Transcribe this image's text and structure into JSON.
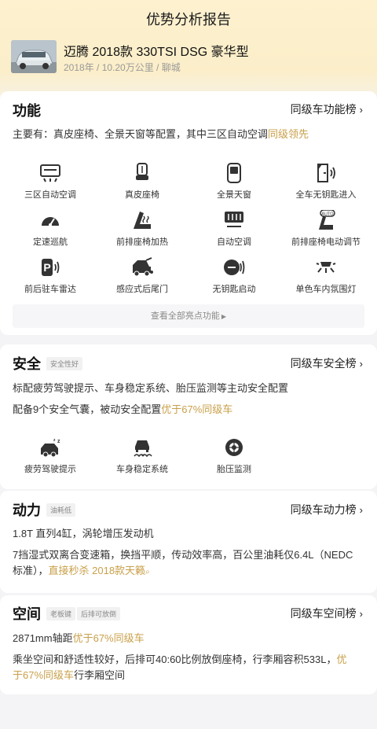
{
  "page": {
    "title": "优势分析报告"
  },
  "car": {
    "name": "迈腾 2018款 330TSI DSG 豪华型",
    "meta": "2018年 / 10.20万公里 / 聊城"
  },
  "function": {
    "title": "功能",
    "rank_link": "同级车功能榜",
    "summary_prefix": "主要有：真皮座椅、全景天窗等配置，其中三区自动空调",
    "summary_highlight": "同级领先",
    "features": [
      {
        "label": "三区自动空调",
        "icon": "ac-vent-icon"
      },
      {
        "label": "真皮座椅",
        "icon": "leather-seat-icon"
      },
      {
        "label": "全景天窗",
        "icon": "sunroof-icon"
      },
      {
        "label": "全车无钥匙进入",
        "icon": "keyless-entry-icon"
      },
      {
        "label": "定速巡航",
        "icon": "cruise-control-icon"
      },
      {
        "label": "前排座椅加热",
        "icon": "seat-heating-icon"
      },
      {
        "label": "自动空调",
        "icon": "auto-ac-icon"
      },
      {
        "label": "前排座椅电动调节",
        "icon": "power-seat-icon"
      },
      {
        "label": "前后驻车雷达",
        "icon": "parking-radar-icon"
      },
      {
        "label": "感应式后尾门",
        "icon": "sensor-tailgate-icon"
      },
      {
        "label": "无钥匙启动",
        "icon": "keyless-start-icon"
      },
      {
        "label": "单色车内氛围灯",
        "icon": "ambient-light-icon"
      }
    ],
    "view_all": "查看全部亮点功能"
  },
  "safety": {
    "title": "安全",
    "tag": "安全性好",
    "rank_link": "同级车安全榜",
    "line1": "标配疲劳驾驶提示、车身稳定系统、胎压监测等主动安全配置",
    "line2_prefix": "配备9个安全气囊，被动安全配置",
    "line2_highlight": "优于67%同级车",
    "features": [
      {
        "label": "疲劳驾驶提示",
        "icon": "fatigue-alert-icon"
      },
      {
        "label": "车身稳定系统",
        "icon": "stability-control-icon"
      },
      {
        "label": "胎压监测",
        "icon": "tire-pressure-icon"
      }
    ]
  },
  "power": {
    "title": "动力",
    "tag": "油耗低",
    "rank_link": "同级车动力榜",
    "line1": "1.8T 直列4缸，涡轮增压发动机",
    "line2a": "7挡湿式双离合变速箱，换挡平顺，传动效率高，百公里油耗仅6.4L（NEDC",
    "line2b_prefix": "标准），",
    "line2b_highlight": "直接秒杀 2018款天籁"
  },
  "space": {
    "title": "空间",
    "tags": [
      "老板键",
      "后排可放倒"
    ],
    "rank_link": "同级车空间榜",
    "line1_prefix": "2871mm轴距",
    "line1_highlight": "优于67%同级车",
    "line2a_prefix": "乘坐空间和舒适性较好，后排可40:60比例放倒座椅，行李厢容积533L，",
    "line2a_highlight": "优",
    "line2b_highlight": "于67%同级车",
    "line2b_suffix": "行李厢空间"
  },
  "colors": {
    "accent": "#c9a04a",
    "hero": "#fbeec9",
    "background": "#f4f4f6"
  }
}
